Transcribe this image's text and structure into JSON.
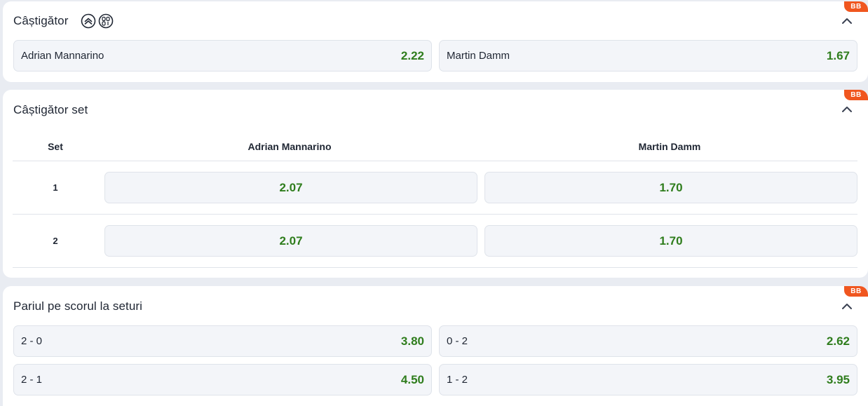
{
  "markets": {
    "winner": {
      "title": "Câștigător",
      "badge": "BB",
      "icons": [
        "stats-icon",
        "scoreboard-icon"
      ],
      "outcomes": [
        {
          "label": "Adrian Mannarino",
          "odds": "2.22"
        },
        {
          "label": "Martin Damm",
          "odds": "1.67"
        }
      ]
    },
    "set_winner": {
      "title": "Câștigător set",
      "badge": "BB",
      "columns": [
        "Set",
        "Adrian Mannarino",
        "Martin Damm"
      ],
      "rows": [
        {
          "set": "1",
          "odds": [
            "2.07",
            "1.70"
          ]
        },
        {
          "set": "2",
          "odds": [
            "2.07",
            "1.70"
          ]
        }
      ]
    },
    "set_score": {
      "title": "Pariul pe scorul la seturi",
      "badge": "BB",
      "outcomes": [
        {
          "label": "2 - 0",
          "odds": "3.80"
        },
        {
          "label": "0 - 2",
          "odds": "2.62"
        },
        {
          "label": "2 - 1",
          "odds": "4.50"
        },
        {
          "label": "1 - 2",
          "odds": "3.95"
        }
      ]
    }
  },
  "colors": {
    "odds_green": "#2f7d1d",
    "badge_orange": "#f0561f",
    "page_bg": "#e9ecf2"
  }
}
